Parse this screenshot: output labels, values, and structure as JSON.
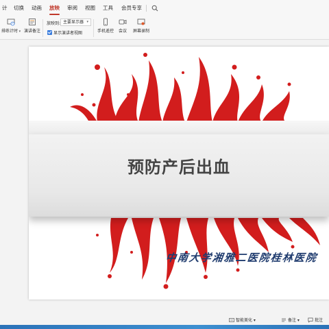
{
  "ribbon": {
    "tabs": [
      {
        "label": "计"
      },
      {
        "label": "切换"
      },
      {
        "label": "动画"
      },
      {
        "label": "放映",
        "active": true
      },
      {
        "label": "审阅"
      },
      {
        "label": "视图"
      },
      {
        "label": "工具"
      },
      {
        "label": "会员专享"
      }
    ],
    "search_icon": "search-icon"
  },
  "toolbar": {
    "rehearse_timing_label": "排练计时",
    "presenter_notes_label": "演讲备注",
    "play_to_label": "放映到:",
    "monitor_value": "主要显示器",
    "show_presenter_view_label": "显示演讲者视图",
    "phone_remote_label": "手机遥控",
    "meeting_label": "会议",
    "screen_record_label": "屏幕录制"
  },
  "slide": {
    "title": "预防产后出血",
    "subtitle": "中南大学湘雅二医院桂林医院"
  },
  "statusbar": {
    "smart_beautify_label": "智能美化",
    "notes_label": "备注",
    "comments_label": "批注"
  },
  "colors": {
    "accent": "#c0392b",
    "splash_red": "#d21d1d",
    "subtitle_blue": "#1f3b6e",
    "taskbar_blue": "#2b72b8"
  }
}
